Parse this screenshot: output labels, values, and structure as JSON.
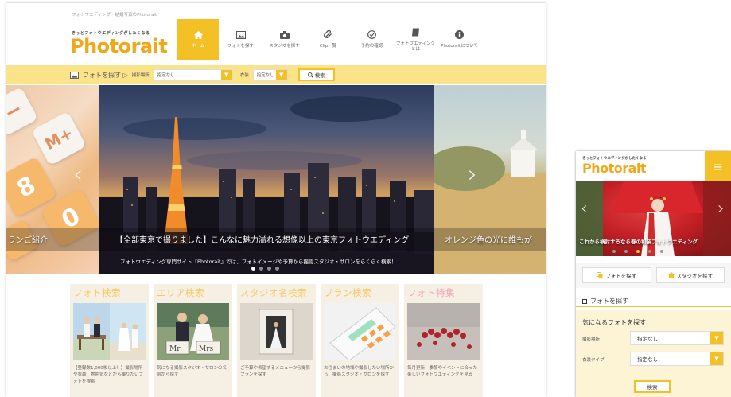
{
  "brand": {
    "tagline": "フォトウエディング・結婚写真のPhotorait",
    "catch": "きっとフォトウエディングがしたくなる",
    "logo": "Photorait",
    "accent": "#f3c026",
    "logo_color": "#f0a71a"
  },
  "topnav": [
    {
      "label": "ホーム",
      "icon": "home-icon",
      "active": true
    },
    {
      "label": "フォトを探す",
      "icon": "image-icon",
      "active": false
    },
    {
      "label": "スタジオを探す",
      "icon": "camera-icon",
      "active": false
    },
    {
      "label": "Clip一覧",
      "icon": "clip-icon",
      "active": false
    },
    {
      "label": "予約の確認",
      "icon": "check-icon",
      "active": false
    },
    {
      "label": "フォトウエディングとは",
      "icon": "book-icon",
      "active": false
    },
    {
      "label": "Photoraitについて",
      "icon": "info-icon",
      "active": false
    }
  ],
  "searchbar": {
    "title": "フォトを探す ▷",
    "location_label": "撮影場所",
    "location_value": "指定なし",
    "costume_label": "衣装",
    "costume_value": "指定なし",
    "button": "検索"
  },
  "slider": {
    "left_caption": "ランご紹介",
    "title": "【全部東京で撮りました】こんなに魅力溢れる想像以上の東京フォトウエディング",
    "subtitle": "フォトウエディング専門サイト『Photorait』では、フォトイメージや予算から撮影スタジオ・サロンをらくらく検索！",
    "right_caption": "オレンジ色の光に誰もが",
    "calc_keys": [
      "M+",
      "8",
      "0"
    ]
  },
  "categories": [
    {
      "title": "フォト検索",
      "color": "#f7c85e",
      "desc": "【登録数1,000枚以上！】撮影場所や衣装、雰囲気などから撮りたいフォトを検索"
    },
    {
      "title": "エリア検索",
      "color": "#f7c85e",
      "desc": "気になる撮影スタジオ・サロンの名前から探す"
    },
    {
      "title": "スタジオ名検索",
      "color": "#f7c85e",
      "desc": "ご予算や希望するメニューから撮影プランを探す"
    },
    {
      "title": "プラン検索",
      "color": "#f7c85e",
      "desc": "お住まいの地域や撮影したい場所から、撮影スタジオ・サロンを探す"
    },
    {
      "title": "フォト特集",
      "color": "#f3a3b8",
      "desc": "毎月更新！季節やイベントに合った楽しいフォトウエディングを見る"
    }
  ],
  "mobile": {
    "catch": "きっとフォトウエディングがしたくなる",
    "logo": "Photorait",
    "slider_caption": "これから検討するなら春の和装フォトウエディング",
    "tab_photo": "フォトを探す",
    "tab_studio": "スタジオを探す",
    "section_title": "フォトを探す",
    "box_title": "気になるフォトを探す",
    "location_label": "撮影場所",
    "location_value": "指定なし",
    "costume_label": "衣装タイプ",
    "costume_value": "指定なし",
    "button": "検索"
  }
}
